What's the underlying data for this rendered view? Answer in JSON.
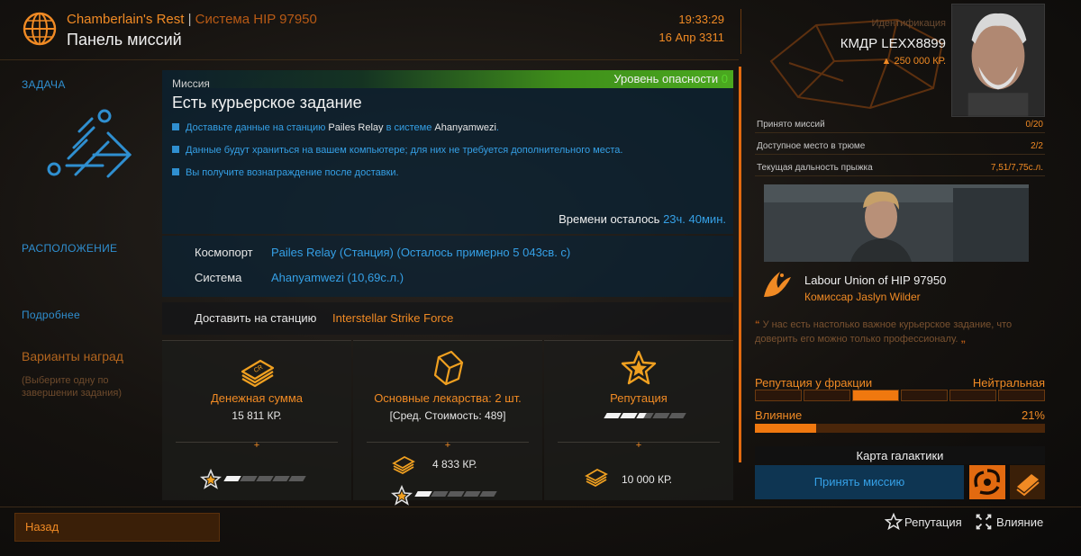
{
  "header": {
    "station": "Chamberlain's Rest",
    "separator": "|",
    "system": "Система HIP 97950",
    "title": "Панель миссий",
    "time": "19:33:29",
    "date": "16 Апр 3311"
  },
  "nav": {
    "task": "ЗАДАЧА",
    "location": "РАСПОЛОЖЕНИЕ",
    "more": "Подробнее",
    "rewards": "Варианты наград",
    "rewards_hint": "(Выберите одну по завершении задания)"
  },
  "mission": {
    "kicker": "Миссия",
    "danger_label": "Уровень опасности",
    "danger_value": "0",
    "title": "Есть курьерское задание",
    "bullets": [
      {
        "pre": "Доставьте данные на станцию ",
        "hl": "Pailes Relay",
        "mid": " в системе ",
        "hl2": "Ahanyamwezi",
        "post": "."
      },
      {
        "text": "Данные будут храниться на вашем компьютере; для них не требуется дополнительного места."
      },
      {
        "text": "Вы получите вознаграждение после доставки."
      }
    ],
    "time_left_label": "Времени осталось",
    "time_left_value": "23ч. 40мин."
  },
  "location": {
    "spaceport_label": "Космопорт",
    "spaceport_value": "Pailes Relay (Станция) (Осталось примерно 5 043св. с)",
    "system_label": "Система",
    "system_value": "Ahanyamwezi (10,69с.л.)",
    "deliver_label": "Доставить на станцию",
    "deliver_value": "Interstellar Strike Force"
  },
  "rewards": [
    {
      "title": "Денежная сумма",
      "sub": "15 811 КР.",
      "plus": "+",
      "extra_rep_level": 1.0
    },
    {
      "title": "Основные лекарства: 2 шт.",
      "sub": "[Сред. Стоимость: 489]",
      "plus": "+",
      "extra_value": "4 833 КР.",
      "extra_rep_level": 1.0
    },
    {
      "title": "Репутация",
      "plus": "+",
      "rep_level": 2.5,
      "extra_value": "10 000 КР."
    }
  ],
  "commander": {
    "ident_label": "Идентификация",
    "name": "КМДР LEXX8899",
    "credits": "250 000 КР."
  },
  "stats": [
    {
      "label": "Принято миссий",
      "value": "0/20"
    },
    {
      "label": "Доступное место в трюме",
      "value": "2/2"
    },
    {
      "label": "Текущая дальность прыжка",
      "value": "7,51/7,75с.л."
    }
  ],
  "faction": {
    "name": "Labour Union of HIP 97950",
    "agent": "Комиссар Jaslyn Wilder",
    "quote": "У нас есть настолько важное курьерское задание, что доверить его можно только профессионалу.",
    "rep_label": "Репутация у фракции",
    "rep_value": "Нейтральная",
    "rep_segments": 6,
    "rep_active_index": 2,
    "influence_label": "Влияние",
    "influence_value": "21%",
    "influence_fraction": 0.21
  },
  "actions": {
    "galaxy_map": "Карта галактики",
    "accept": "Принять миссию",
    "back": "Назад",
    "legend_rep": "Репутация",
    "legend_inf": "Влияние"
  },
  "colors": {
    "accent_orange": "#f08a24",
    "accent_blue": "#35a0e6",
    "danger_green": "#59d32c"
  }
}
